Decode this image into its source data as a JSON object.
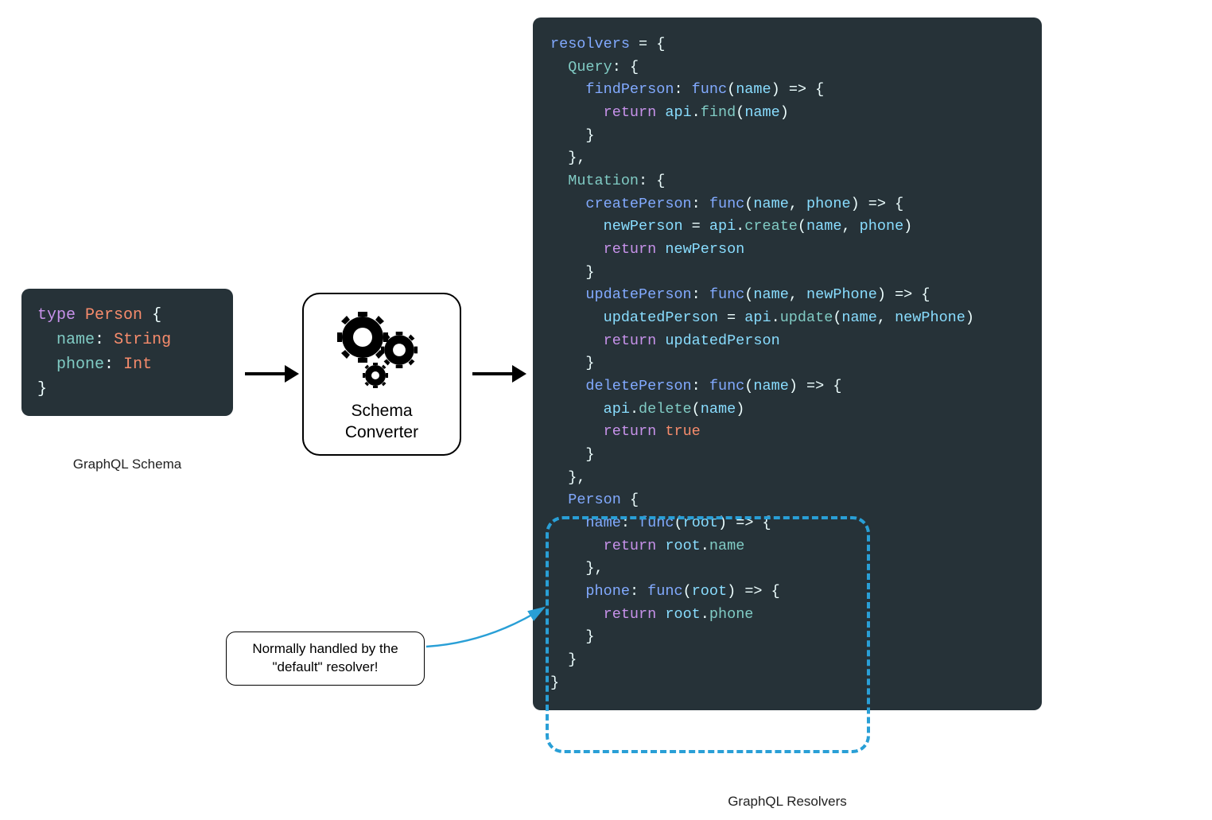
{
  "schema": {
    "caption": "GraphQL Schema",
    "code": {
      "kw_type": "type",
      "type_name": "Person",
      "brace_open": "{",
      "field1_name": "name",
      "field1_type": "String",
      "field2_name": "phone",
      "field2_type": "Int",
      "brace_close": "}",
      "colon": ":"
    }
  },
  "converter": {
    "line1": "Schema",
    "line2": "Converter"
  },
  "resolvers": {
    "caption": "GraphQL Resolvers",
    "code": {
      "resolvers_var": "resolvers",
      "eq": " = ",
      "Query": "Query",
      "Mutation": "Mutation",
      "Person": "Person",
      "findPerson": "findPerson",
      "createPerson": "createPerson",
      "updatePerson": "updatePerson",
      "deletePerson": "deletePerson",
      "name_field": "name",
      "phone_field": "phone",
      "func": "func",
      "return": "return",
      "api": "api",
      "find": "find",
      "create": "create",
      "update": "update",
      "delete": "delete",
      "true": "true",
      "name_param": "name",
      "phone_param": "phone",
      "newPhone_param": "newPhone",
      "root_param": "root",
      "newPerson": "newPerson",
      "updatedPerson": "updatedPerson",
      "root_name": "name",
      "root_phone": "phone"
    }
  },
  "callout": {
    "text1": "Normally handled by the",
    "text2": "\"default\" resolver!"
  }
}
